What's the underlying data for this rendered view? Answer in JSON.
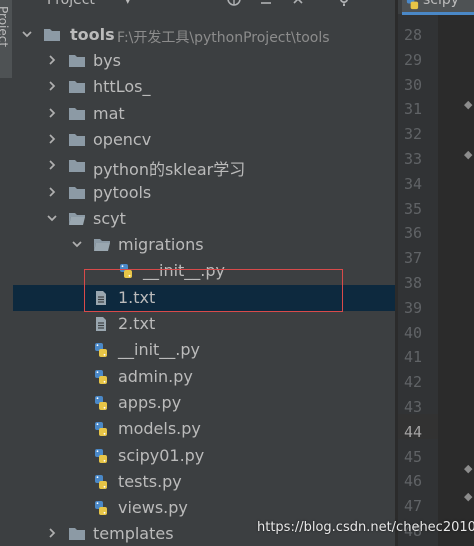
{
  "sidebar_tab": {
    "label": "Project"
  },
  "panel": {
    "title": "Project",
    "header_icons": [
      "globe-icon",
      "collapse-icon",
      "settings-icon",
      "gear-icon",
      "minimize-icon"
    ]
  },
  "tree": {
    "root": {
      "name": "tools",
      "path": "F:\\开发工具\\pythonProject\\tools"
    },
    "items": [
      {
        "label": "bys",
        "type": "folder"
      },
      {
        "label": "httLos_",
        "type": "folder"
      },
      {
        "label": "mat",
        "type": "folder"
      },
      {
        "label": "opencv",
        "type": "folder"
      },
      {
        "label": "python的sklear学习",
        "type": "folder"
      },
      {
        "label": "pytools",
        "type": "folder"
      },
      {
        "label": "scyt",
        "type": "folder-open"
      },
      {
        "label": "migrations",
        "type": "folder-open"
      },
      {
        "label": "__init__.py",
        "type": "python"
      },
      {
        "label": "1.txt",
        "type": "text"
      },
      {
        "label": "2.txt",
        "type": "text"
      },
      {
        "label": "__init__.py",
        "type": "python"
      },
      {
        "label": "admin.py",
        "type": "python"
      },
      {
        "label": "apps.py",
        "type": "python"
      },
      {
        "label": "models.py",
        "type": "python"
      },
      {
        "label": "scipy01.py",
        "type": "python"
      },
      {
        "label": "tests.py",
        "type": "python"
      },
      {
        "label": "views.py",
        "type": "python"
      },
      {
        "label": "templates",
        "type": "folder"
      }
    ]
  },
  "editor": {
    "tab_label": "scipy",
    "line_numbers": [
      "28",
      "29",
      "30",
      "31",
      "32",
      "33",
      "34",
      "35",
      "36",
      "37",
      "38",
      "39",
      "40",
      "41",
      "42",
      "43",
      "44",
      "45",
      "46",
      "47",
      "48"
    ],
    "current_line": "44"
  },
  "watermark": "https://blog.csdn.net/chehec2010",
  "colors": {
    "panel_bg": "#3c3f41",
    "selection": "#0d293e",
    "highlight_box": "#d84a4a",
    "text": "#bbbbbb",
    "folder": "#8c9aa5",
    "tab_underline": "#4a88c7"
  }
}
